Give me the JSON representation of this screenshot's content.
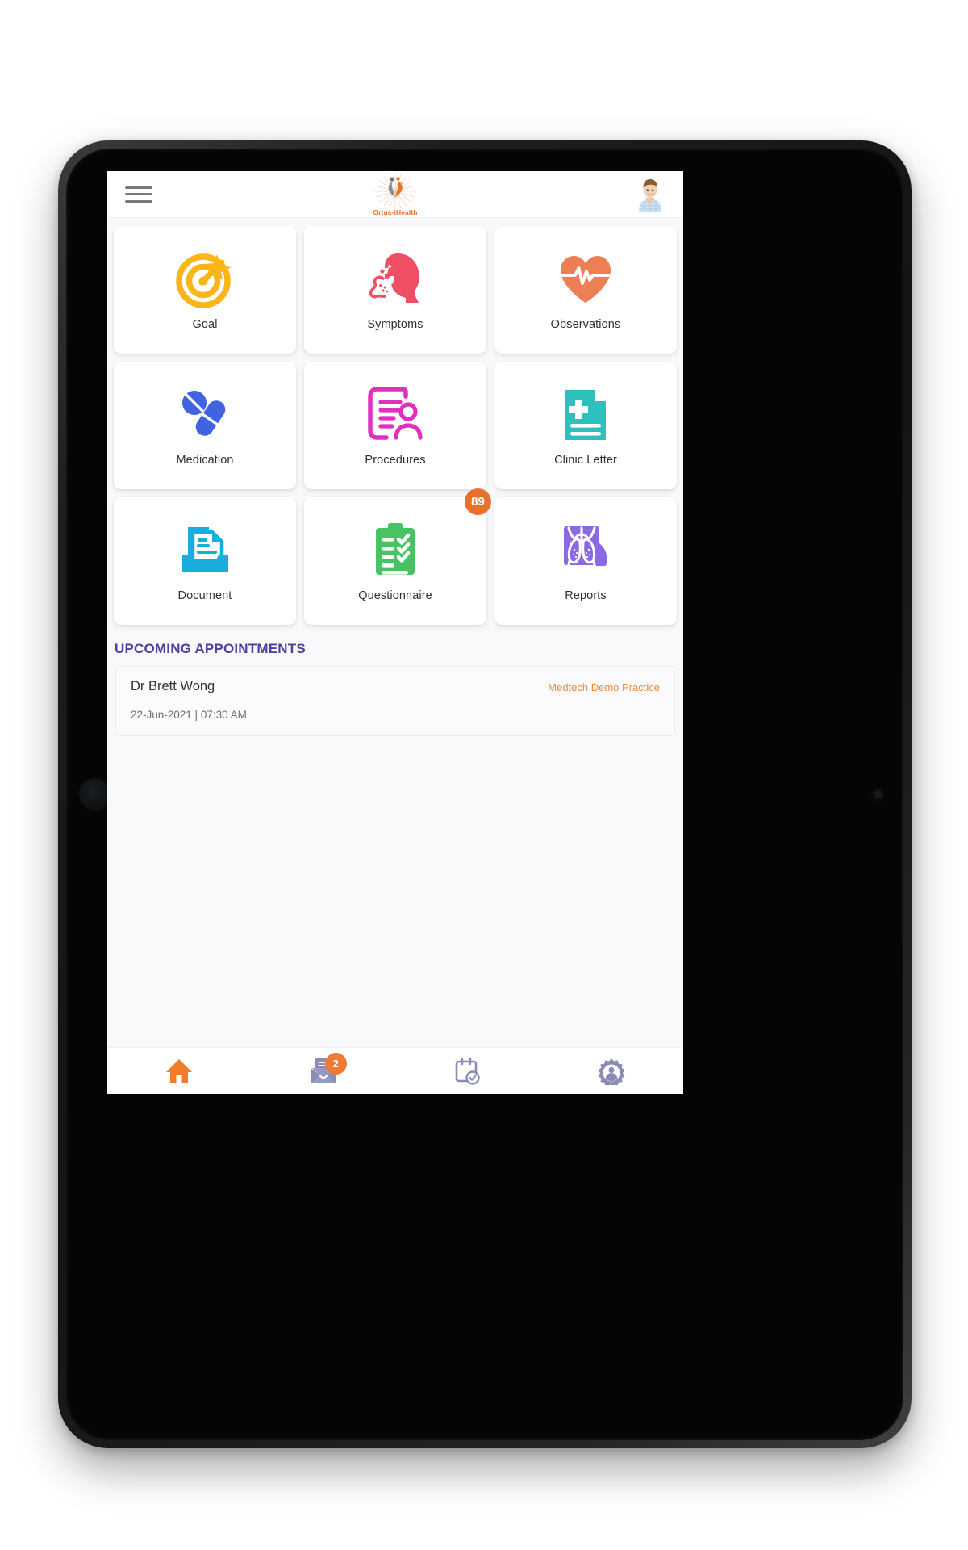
{
  "app": {
    "brand_name": "Ortus-iHealth",
    "brand_color": "#e8722c"
  },
  "header": {
    "menu_icon": "hamburger-menu-icon",
    "logo_icon": "ortus-ihealth-logo-icon",
    "avatar_icon": "patient-avatar-icon"
  },
  "tiles": [
    {
      "label": "Goal",
      "icon": "target-goal-icon",
      "color": "#fbb516",
      "badge": null
    },
    {
      "label": "Symptoms",
      "icon": "coughing-person-icon",
      "color": "#ef4f63",
      "badge": null
    },
    {
      "label": "Observations",
      "icon": "heart-pulse-icon",
      "color": "#ee7f54",
      "badge": null
    },
    {
      "label": "Medication",
      "icon": "pills-capsule-icon",
      "color": "#4064e0",
      "badge": null
    },
    {
      "label": "Procedures",
      "icon": "document-person-icon",
      "color": "#e030c0",
      "badge": null
    },
    {
      "label": "Clinic Letter",
      "icon": "medical-letter-icon",
      "color": "#2dc0bd",
      "badge": null
    },
    {
      "label": "Document",
      "icon": "document-tray-icon",
      "color": "#15aedd",
      "badge": null
    },
    {
      "label": "Questionnaire",
      "icon": "clipboard-checklist-icon",
      "color": "#47c363",
      "badge": "89"
    },
    {
      "label": "Reports",
      "icon": "chest-xray-lungs-icon",
      "color": "#8a6ae0",
      "badge": null
    }
  ],
  "appointments": {
    "heading": "UPCOMING APPOINTMENTS",
    "heading_color": "#4b3f9e",
    "items": [
      {
        "doctor": "Dr Brett Wong",
        "practice": "Medtech Demo Practice",
        "datetime": "22-Jun-2021 | 07:30 AM",
        "practice_color": "#ef8a3c"
      }
    ]
  },
  "bottom_nav": {
    "items": [
      {
        "name": "home",
        "icon": "home-icon",
        "active": true,
        "badge": null
      },
      {
        "name": "messages",
        "icon": "mail-envelope-icon",
        "active": false,
        "badge": "2"
      },
      {
        "name": "calendar",
        "icon": "calendar-check-icon",
        "active": false,
        "badge": null
      },
      {
        "name": "settings",
        "icon": "gear-user-icon",
        "active": false,
        "badge": null
      }
    ],
    "active_color": "#f07d2e",
    "inactive_color": "#8b8cb5"
  }
}
